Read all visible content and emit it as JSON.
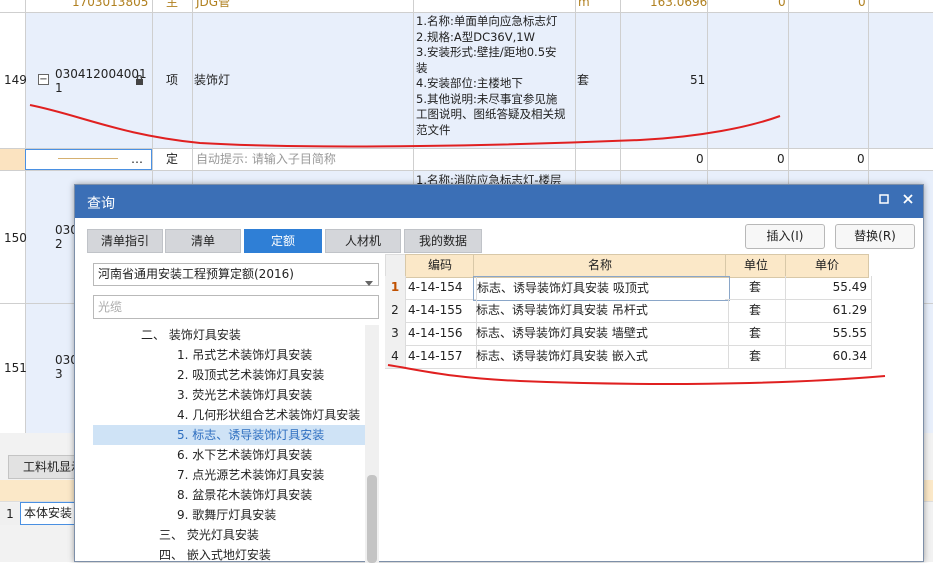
{
  "grid": {
    "top_row": {
      "code": "1703013805",
      "type": "主",
      "name": "JDG管",
      "unit": "m",
      "qty": "163.0696",
      "v1": "0",
      "v2": "0"
    },
    "rows": [
      {
        "num": "149",
        "code_l1": "030412004001",
        "code_l2": "1",
        "type": "项",
        "name": "装饰灯",
        "desc": [
          "1.名称:单面单向应急标志灯",
          "2.规格:A型DC36V,1W",
          "3.安装形式:壁挂/距地0.5安",
          "装",
          "4.安装部位:主楼地下",
          "5.其他说明:未尽事宜参见施",
          "工图说明、图纸答疑及相关规",
          "范文件"
        ],
        "unit": "套",
        "qty": "51"
      },
      {
        "num": "",
        "code_l1": "…",
        "type": "定",
        "name": "自动提示: 请输入子目简称",
        "v1": "0",
        "v2": "0",
        "v3": "0"
      },
      {
        "num": "150",
        "code_l1": "030",
        "code_l2": "2",
        "desc": [
          "1.名称:消防应急标志灯-楼层"
        ]
      },
      {
        "num": "151",
        "code_l1": "030",
        "code_l2": "3"
      }
    ]
  },
  "bottom": {
    "tab": "工料机显示",
    "row_num": "1",
    "cell": "本体安装"
  },
  "dialog": {
    "title": "查询",
    "tabs": [
      "清单指引",
      "清单",
      "定额",
      "人材机",
      "我的数据"
    ],
    "active_tab": 2,
    "insert_btn": "插入(I)",
    "replace_btn": "替换(R)",
    "quota_lib": "河南省通用安装工程预算定额(2016)",
    "search_placeholder": "光缆",
    "tree": [
      {
        "label": "二、 装饰灯具安装",
        "level": 0
      },
      {
        "label": "1. 吊式艺术装饰灯具安装",
        "level": 1
      },
      {
        "label": "2. 吸顶式艺术装饰灯具安装",
        "level": 1
      },
      {
        "label": "3. 荧光艺术装饰灯具安装",
        "level": 1
      },
      {
        "label": "4. 几何形状组合艺术装饰灯具安装",
        "level": 1
      },
      {
        "label": "5. 标志、诱导装饰灯具安装",
        "level": 1,
        "selected": true
      },
      {
        "label": "6. 水下艺术装饰灯具安装",
        "level": 1
      },
      {
        "label": "7. 点光源艺术装饰灯具安装",
        "level": 1
      },
      {
        "label": "8. 盆景花木装饰灯具安装",
        "level": 1
      },
      {
        "label": "9. 歌舞厅灯具安装",
        "level": 1
      },
      {
        "label": "三、 荧光灯具安装",
        "level": 0
      },
      {
        "label": "四、 嵌入式地灯安装",
        "level": 0
      }
    ],
    "table": {
      "headers": [
        "编码",
        "名称",
        "单位",
        "单价"
      ],
      "rows": [
        {
          "n": "1",
          "code": "4-14-154",
          "name": "标志、诱导装饰灯具安装 吸顶式",
          "unit": "套",
          "price": "55.49"
        },
        {
          "n": "2",
          "code": "4-14-155",
          "name": "标志、诱导装饰灯具安装 吊杆式",
          "unit": "套",
          "price": "61.29"
        },
        {
          "n": "3",
          "code": "4-14-156",
          "name": "标志、诱导装饰灯具安装 墙壁式",
          "unit": "套",
          "price": "55.55"
        },
        {
          "n": "4",
          "code": "4-14-157",
          "name": "标志、诱导装饰灯具安装 嵌入式",
          "unit": "套",
          "price": "60.34"
        }
      ]
    }
  },
  "colors": {
    "accent": "#2f7fd6",
    "titlebar": "#3b6fb6",
    "annotation": "#e02020"
  }
}
